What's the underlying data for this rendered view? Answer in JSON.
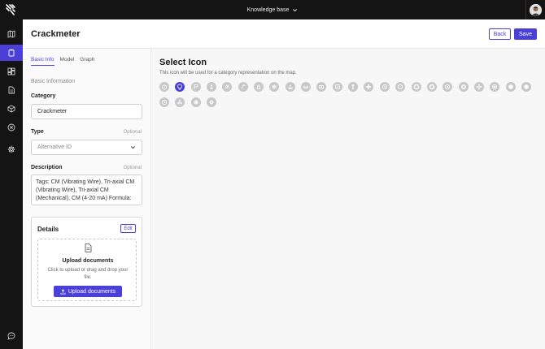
{
  "topbar": {
    "workspace_label": "Knowledge base",
    "workspace_icon": "chevron-down-icon",
    "logo_icon": "brand-logo-icon",
    "avatar_icon": "user-avatar"
  },
  "sidebar": {
    "items": [
      {
        "icon": "map-icon",
        "active": false
      },
      {
        "icon": "clipboard-icon",
        "active": true
      },
      {
        "icon": "dashboard-icon",
        "active": false
      },
      {
        "icon": "document-icon",
        "active": false
      },
      {
        "icon": "cube-icon",
        "active": false
      },
      {
        "icon": "close-circle-icon",
        "active": false
      },
      {
        "icon": "gear-icon",
        "active": false
      }
    ],
    "bottom_icon": "chat-icon"
  },
  "header": {
    "title": "Crackmeter",
    "back_label": "Back",
    "save_label": "Save"
  },
  "form": {
    "tabs": [
      {
        "label": "Basic Info",
        "active": true
      },
      {
        "label": "Model",
        "active": false
      },
      {
        "label": "Graph",
        "active": false
      }
    ],
    "section_label": "Basic Information",
    "category": {
      "label": "Category",
      "value": "Crackmeter"
    },
    "type": {
      "label": "Type",
      "optional": "Optional",
      "placeholder": "Alternative ID"
    },
    "description": {
      "label": "Description",
      "optional": "Optional",
      "value": "Tags: CM (Vibrating Wire), Tri-axial CM (Vibrating Wire), Tri-axial CM (Mechanical), CM (4-20 mA) Formula:"
    },
    "details": {
      "title": "Details",
      "edit_label": "Edit",
      "upload_title": "Upload documents",
      "upload_help": "Click to upload or drag and drop your file.",
      "upload_button": "Upload documents"
    }
  },
  "icon_picker": {
    "title": "Select Icon",
    "subtitle": "This icon will be used for a category representation on the map.",
    "selected_index": 1,
    "icons": [
      "gauge-icon",
      "lightbulb-icon",
      "flag-icon",
      "anchor-icon",
      "satellite-icon",
      "pipe-icon",
      "level-icon",
      "pressure-icon",
      "anchor-alt-icon",
      "wave-icon",
      "camera-icon",
      "plate-icon",
      "thermometer-icon",
      "tilt-icon",
      "crosshair-icon",
      "ring-icon",
      "ring-icon-2",
      "ring-icon-3",
      "ring-icon-4",
      "target-icon",
      "move-icon",
      "record-icon",
      "dot-icon",
      "hexagon-icon",
      "clock-icon",
      "cluster-icon",
      "gear-icon",
      "diamond-icon"
    ]
  },
  "colors": {
    "accent": "#4a3fd6",
    "sidebar_bg": "#141414",
    "icon_gray": "#c8c8c8"
  }
}
